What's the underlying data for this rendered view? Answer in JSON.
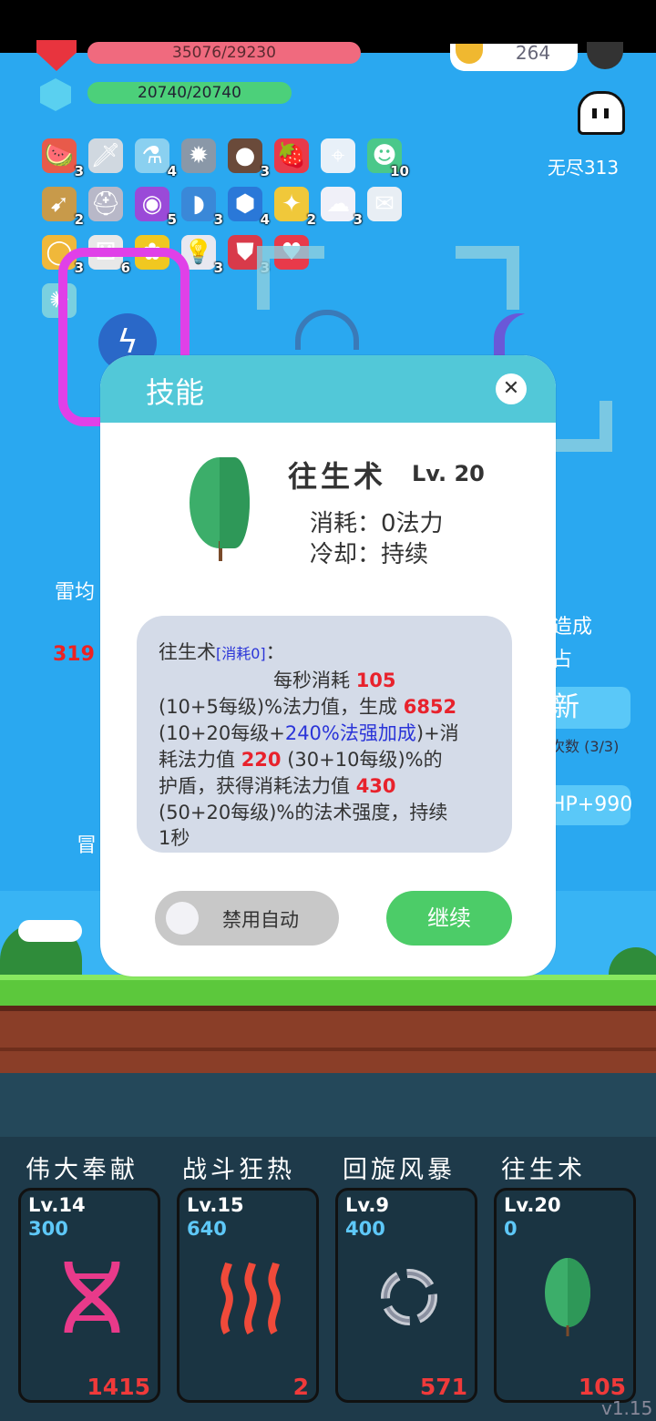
{
  "hud": {
    "hp_text": "35076/29230",
    "mp_text": "20740/20740",
    "coins": "264",
    "wave_label": "无尽313"
  },
  "items": [
    {
      "icon": "watermelon-icon",
      "glyph": "🍉",
      "count": "3",
      "bg": "#e85a4a"
    },
    {
      "icon": "sword-icon",
      "glyph": "🗡",
      "count": "",
      "bg": "#d0d8e0"
    },
    {
      "icon": "potion-icon",
      "glyph": "⚗",
      "count": "4",
      "bg": "#8ad0f0"
    },
    {
      "icon": "spiked-ball-icon",
      "glyph": "✹",
      "count": "",
      "bg": "#8a98a8"
    },
    {
      "icon": "coconut-icon",
      "glyph": "●",
      "count": "3",
      "bg": "#6a4a3a"
    },
    {
      "icon": "strawberry-icon",
      "glyph": "🍓",
      "count": "",
      "bg": "#e83a4a"
    },
    {
      "icon": "target-icon",
      "glyph": "⌖",
      "count": "",
      "bg": "#e8f0f8"
    },
    {
      "icon": "green-ghost-icon",
      "glyph": "☻",
      "count": "10",
      "bg": "#4ac88a"
    },
    {
      "icon": "crossbow-icon",
      "glyph": "➹",
      "count": "2",
      "bg": "#c89a4a"
    },
    {
      "icon": "viking-helmet-icon",
      "glyph": "⛑",
      "count": "",
      "bg": "#b8b8c8"
    },
    {
      "icon": "crystal-ball-icon",
      "glyph": "◉",
      "count": "5",
      "bg": "#9a4ad8"
    },
    {
      "icon": "fish-icon",
      "glyph": "◗",
      "count": "3",
      "bg": "#3a88d8"
    },
    {
      "icon": "blue-gem-icon",
      "glyph": "⬢",
      "count": "4",
      "bg": "#2a78d8"
    },
    {
      "icon": "magic-wand-icon",
      "glyph": "✦",
      "count": "2",
      "bg": "#f0c83a"
    },
    {
      "icon": "white-ghost-icon",
      "glyph": "☁",
      "count": "3",
      "bg": "#f0f0f8"
    },
    {
      "icon": "envelope-icon",
      "glyph": "✉",
      "count": "",
      "bg": "#e8eef4"
    },
    {
      "icon": "ring-icon",
      "glyph": "◯",
      "count": "3",
      "bg": "#f0b83a"
    },
    {
      "icon": "dice-icon",
      "glyph": "⚅",
      "count": "6",
      "bg": "#e8e8e8"
    },
    {
      "icon": "sunflower-icon",
      "glyph": "✿",
      "count": "",
      "bg": "#f0c820"
    },
    {
      "icon": "lightbulb-icon",
      "glyph": "💡",
      "count": "3",
      "bg": "#e8e8f0"
    },
    {
      "icon": "shield-icon",
      "glyph": "⛊",
      "count": "3",
      "bg": "#d83a4a"
    },
    {
      "icon": "hearts-icon",
      "glyph": "♥",
      "count": "",
      "bg": "#e83a4a"
    },
    {
      "icon": "glowing-bulb-icon",
      "glyph": "✺",
      "count": "",
      "bg": "#7ad0e0"
    }
  ],
  "background": {
    "text_a": "雷均",
    "text_b": "319",
    "text_c": "造成",
    "text_d": "占",
    "refresh_label": "新",
    "refresh_count": "次数 (3/3)",
    "hp_bonus": "HP+990",
    "text_f": "冒"
  },
  "dialog": {
    "title": "技能",
    "skill_name": "往生术",
    "skill_level": "Lv. 20",
    "cost_line": "消耗：0法力",
    "cooldown_line": "冷却：持续",
    "desc": {
      "l1_name": "往生术",
      "l1_tag": "[消耗0]",
      "l1_tail": "：",
      "l2_pre": "每秒消耗 ",
      "l2_val": "105",
      "l3_pre": "(10+5每级)%法力值，生成 ",
      "l3_val": "6852",
      "l4_pre": "(10+20每级+",
      "l4_blue": "240%法强加成",
      "l4_post": ")+消",
      "l5_pre": "耗法力值 ",
      "l5_val": "220",
      "l5_post": " (30+10每级)%的",
      "l6_pre": "护盾，获得消耗法力值 ",
      "l6_val": "430",
      "l7": "(50+20每级)%的法术强度，持续",
      "l8": "1秒"
    },
    "toggle_label": "禁用自动",
    "continue_label": "继续"
  },
  "slots": [
    {
      "name": "伟大奉献",
      "level": "Lv.14",
      "cost": "300",
      "count": "1415",
      "icon": "dna-icon"
    },
    {
      "name": "战斗狂热",
      "level": "Lv.15",
      "cost": "640",
      "count": "2",
      "icon": "heat-waves-icon"
    },
    {
      "name": "回旋风暴",
      "level": "Lv.9",
      "cost": "400",
      "count": "571",
      "icon": "cycle-arrows-icon"
    },
    {
      "name": "往生术",
      "level": "Lv.20",
      "cost": "0",
      "count": "105",
      "icon": "leaf-icon"
    }
  ],
  "version": "v1.15",
  "colors": {
    "sky": "#2aa8f0",
    "dialog_header": "#52c8d8",
    "continue": "#4ccc68",
    "red_value": "#e8222c",
    "blue_value": "#2a34d8"
  }
}
